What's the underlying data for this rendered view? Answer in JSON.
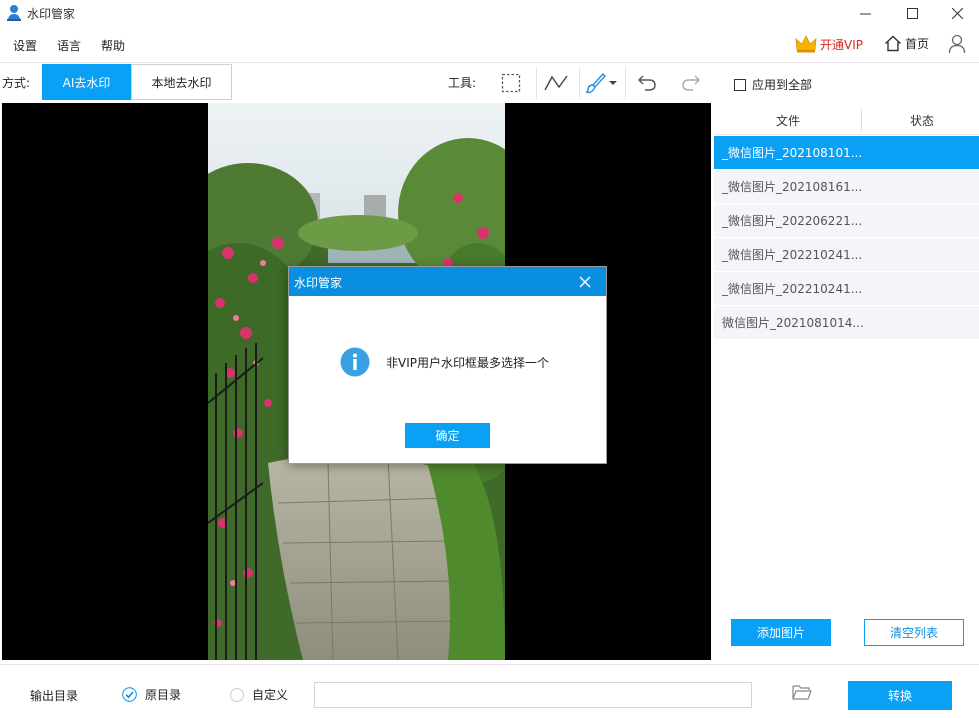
{
  "app": {
    "title": "水印管家"
  },
  "menu": {
    "items": [
      {
        "label": "设置"
      },
      {
        "label": "语言"
      },
      {
        "label": "帮助"
      }
    ],
    "vip_label": "开通VIP",
    "home_label": "首页"
  },
  "mode": {
    "label": "方式:",
    "tabs": [
      {
        "label": "AI去水印",
        "active": true
      },
      {
        "label": "本地去水印",
        "active": false
      }
    ]
  },
  "tools": {
    "label": "工具:",
    "items": [
      {
        "icon": "rect-select-icon"
      },
      {
        "icon": "polyline-icon"
      },
      {
        "icon": "brush-icon"
      },
      {
        "icon": "undo-icon"
      },
      {
        "icon": "redo-icon"
      }
    ],
    "apply_all_label": "应用到全部"
  },
  "file_panel": {
    "columns": {
      "file": "文件",
      "status": "状态"
    },
    "files": [
      {
        "name": "_微信图片_202108101...",
        "selected": true
      },
      {
        "name": "_微信图片_202108161...",
        "selected": false
      },
      {
        "name": "_微信图片_202206221...",
        "selected": false
      },
      {
        "name": "_微信图片_202210241...",
        "selected": false
      },
      {
        "name": "_微信图片_202210241...",
        "selected": false
      },
      {
        "name": "微信图片_2021081014...",
        "selected": false
      }
    ],
    "add_button": "添加图片",
    "clear_button": "清空列表"
  },
  "output": {
    "label": "输出目录",
    "options": [
      {
        "label": "原目录",
        "checked": true
      },
      {
        "label": "自定义",
        "checked": false
      }
    ],
    "path_value": "",
    "convert_button": "转换"
  },
  "dialog": {
    "title": "水印管家",
    "message": "非VIP用户水印框最多选择一个",
    "ok_button": "确定"
  },
  "colors": {
    "accent": "#0aa0f5",
    "dialog_title_bg": "#0a8fe0",
    "vip_red": "#d9261c"
  }
}
